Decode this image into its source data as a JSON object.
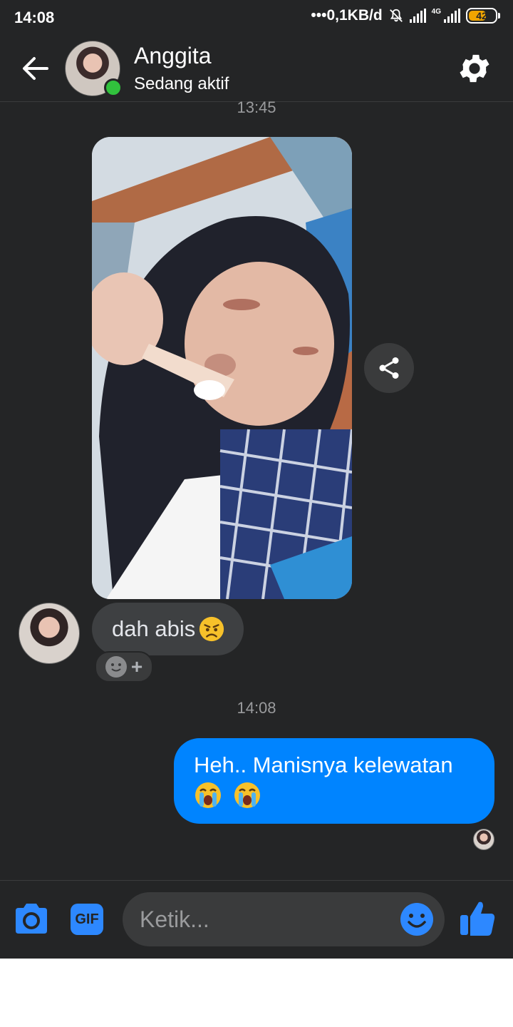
{
  "status_bar": {
    "time": "14:08",
    "network_speed": "•••0,1KB/d",
    "network_type": "4G",
    "battery": "42"
  },
  "header": {
    "contact_name": "Anggita",
    "contact_status": "Sedang aktif"
  },
  "messages": {
    "timestamp_1": "13:45",
    "incoming_text": "dah abis",
    "timestamp_2": "14:08",
    "outgoing_text": "Heh.. Manisnya kelewatan"
  },
  "composer": {
    "gif_label": "GIF",
    "placeholder": "Ketik..."
  },
  "colors": {
    "background": "#242526",
    "outgoing_bubble": "#0084ff",
    "incoming_bubble": "#3e4042",
    "accent": "#2d88ff",
    "online": "#31c23d"
  }
}
